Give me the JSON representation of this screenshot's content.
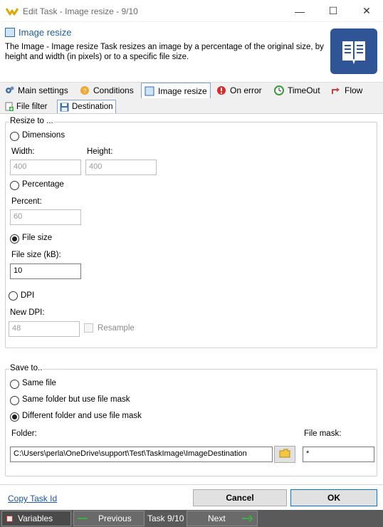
{
  "window": {
    "title": "Edit Task - Image resize - 9/10",
    "minimize_glyph": "—",
    "maximize_glyph": "☐",
    "close_glyph": "✕"
  },
  "header": {
    "title": "Image resize",
    "description": "The Image - Image resize Task resizes an image by a percentage of the original size, by height and width (in pixels) or to a specific file size."
  },
  "tabs": [
    {
      "label": "Main settings",
      "icon": "gears-icon"
    },
    {
      "label": "Conditions",
      "icon": "conditions-icon"
    },
    {
      "label": "Image resize",
      "icon": "image-resize-icon",
      "active": true
    },
    {
      "label": "On error",
      "icon": "error-icon"
    },
    {
      "label": "TimeOut",
      "icon": "timeout-icon"
    },
    {
      "label": "Flow",
      "icon": "flow-icon"
    }
  ],
  "subtabs": [
    {
      "label": "File filter",
      "icon": "file-filter-icon"
    },
    {
      "label": "Destination",
      "icon": "save-icon",
      "active": true
    }
  ],
  "resize": {
    "legend": "Resize to ...",
    "dimensions_label": "Dimensions",
    "width_label": "Width:",
    "width_value": "400",
    "height_label": "Height:",
    "height_value": "400",
    "percentage_label": "Percentage",
    "percent_label": "Percent:",
    "percent_value": "60",
    "filesize_label": "File size",
    "filesize_kb_label": "File size (kB):",
    "filesize_value": "10",
    "dpi_label": "DPI",
    "newdpi_label": "New DPI:",
    "newdpi_value": "48",
    "resample_label": "Resample",
    "selected": "File size"
  },
  "save": {
    "legend": "Save to..",
    "same_file": "Same file",
    "same_folder": "Same folder but use file mask",
    "different_folder": "Different folder and use file mask",
    "selected": "Different folder and use file mask",
    "folder_label": "Folder:",
    "folder_value": "C:\\Users\\perla\\OneDrive\\support\\Test\\TaskImage\\ImageDestination",
    "filemask_label": "File mask:",
    "filemask_value": "*"
  },
  "bottom": {
    "copy_task_link": "Copy Task Id",
    "cancel_label": "Cancel",
    "ok_label": "OK"
  },
  "nav": {
    "variables_label": "Variables",
    "previous_label": "Previous",
    "task_counter": "Task 9/10",
    "next_label": "Next"
  },
  "colors": {
    "accent": "#1f5fa6",
    "nav_bg": "#5a5a5a",
    "arrow_green": "#3cb043"
  }
}
